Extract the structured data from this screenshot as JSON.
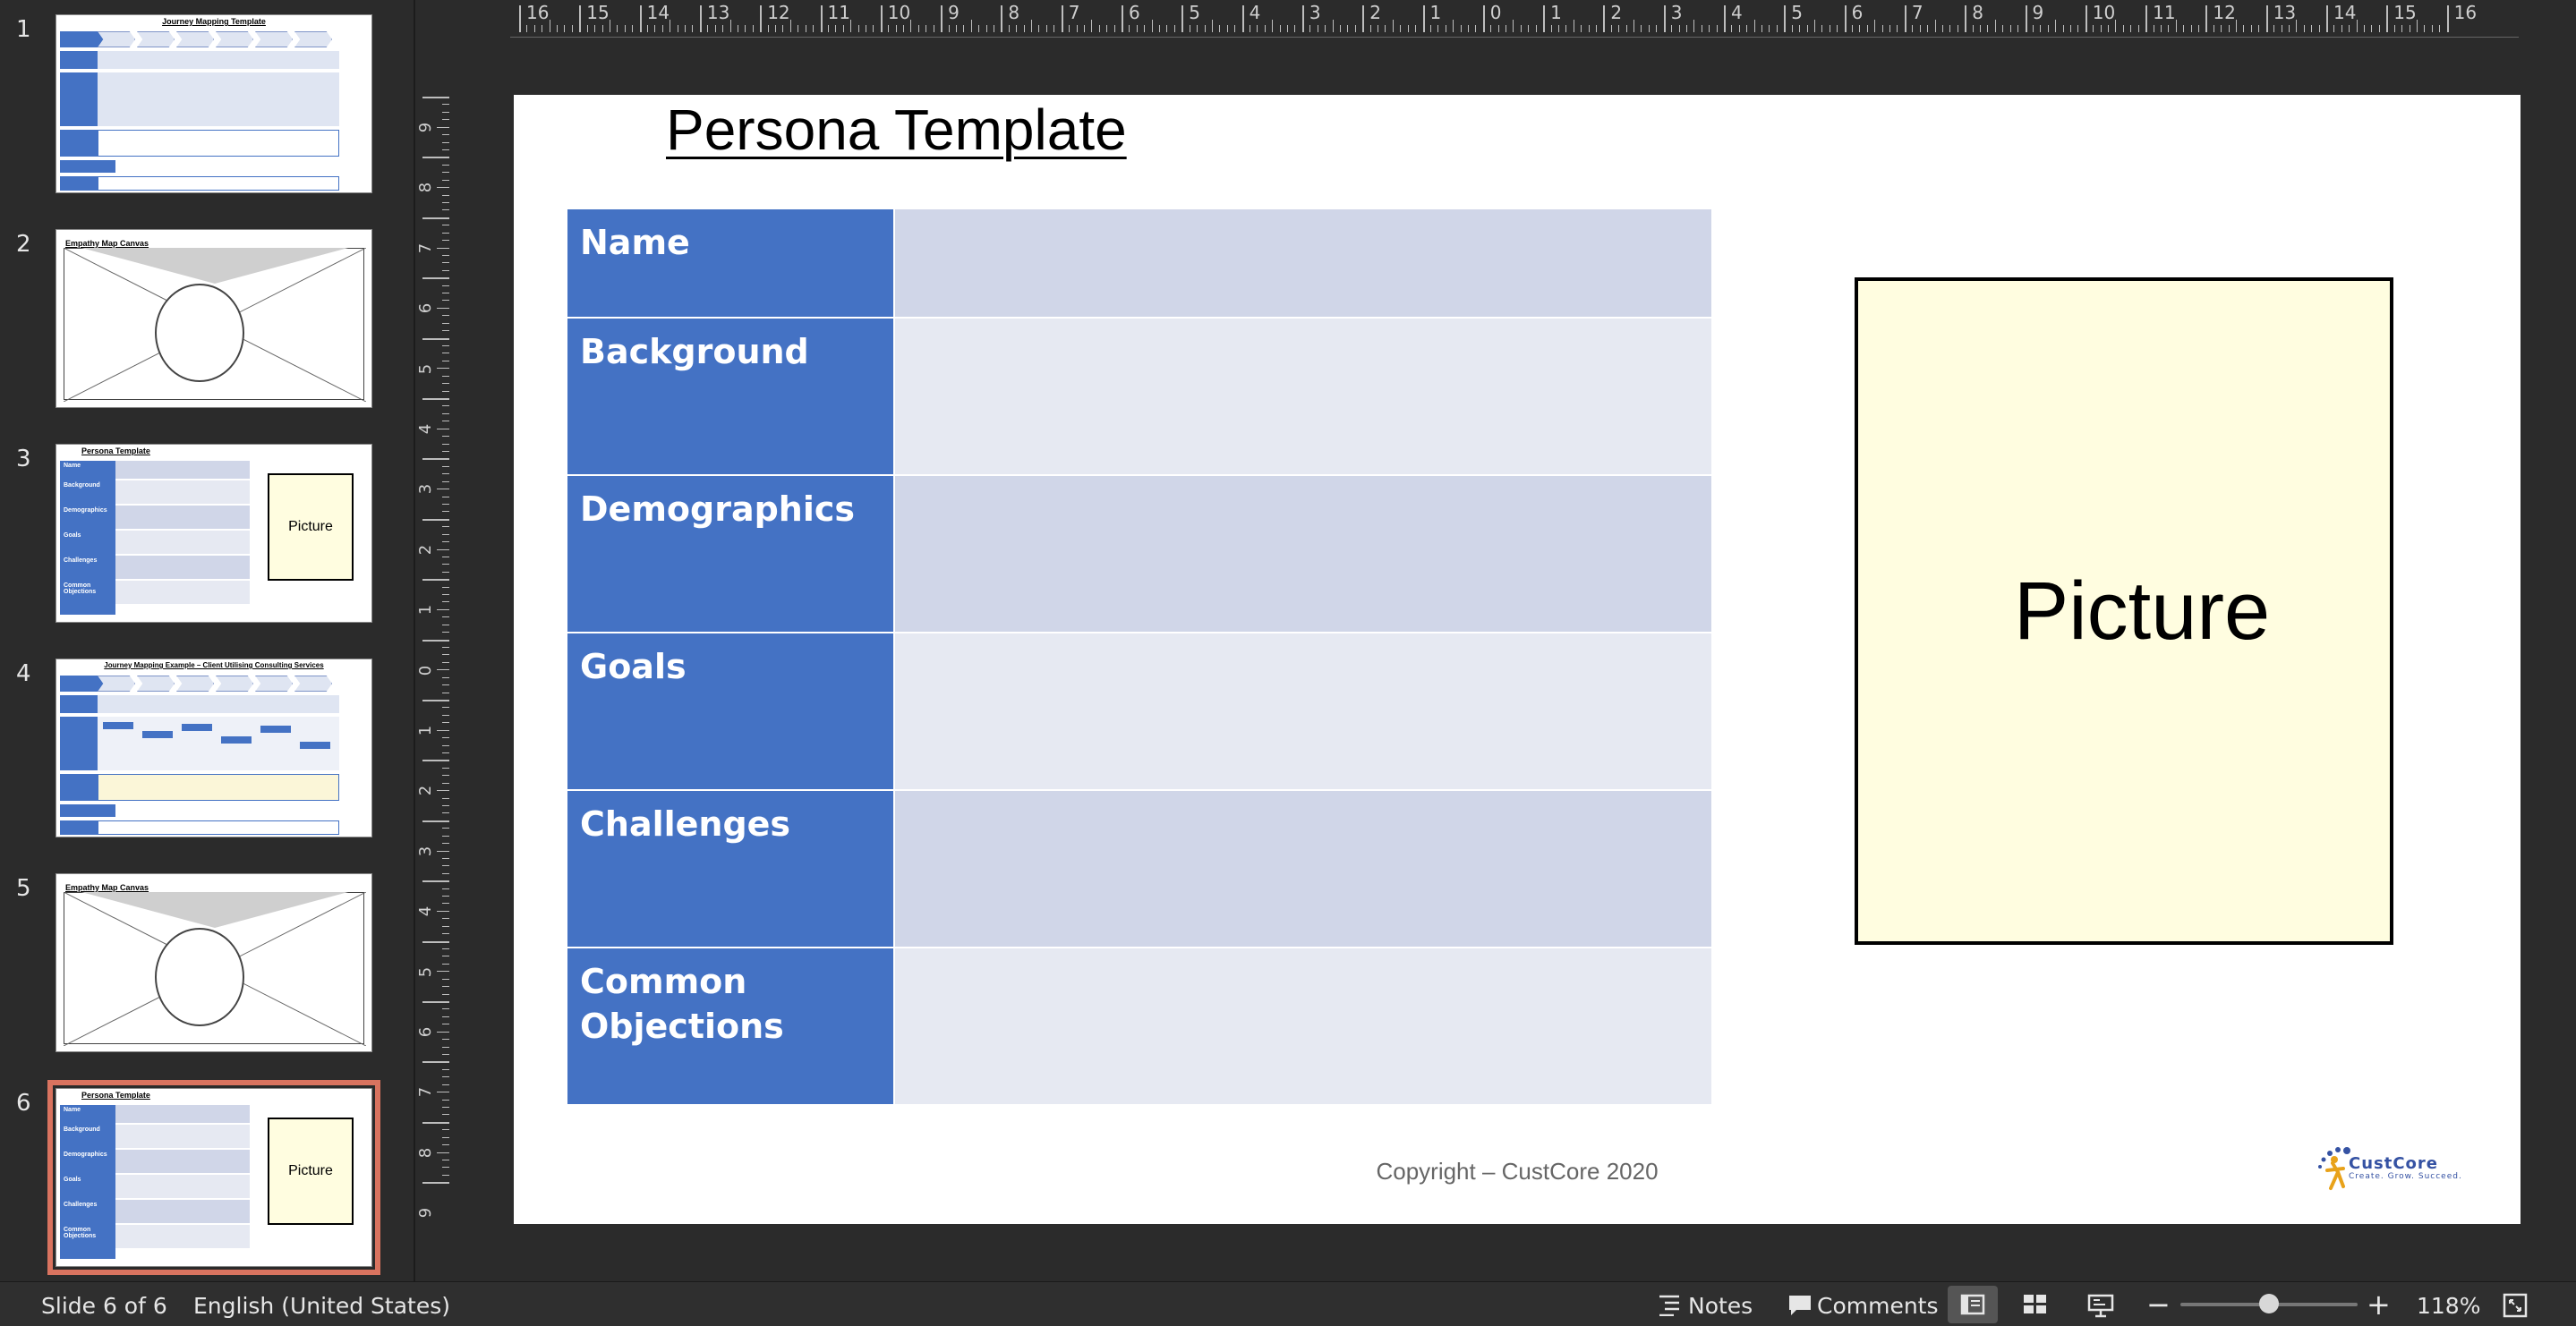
{
  "sidebar": {
    "slides": [
      {
        "number": "1",
        "title": "Journey Mapping Template"
      },
      {
        "number": "2",
        "title": "Empathy Map Canvas"
      },
      {
        "number": "3",
        "title": "Persona Template",
        "picture_label": "Picture"
      },
      {
        "number": "4",
        "title": "Journey Mapping Example – Client Utilising Consulting Services"
      },
      {
        "number": "5",
        "title": "Empathy Map Canvas"
      },
      {
        "number": "6",
        "title": "Persona Template",
        "picture_label": "Picture",
        "selected": true
      }
    ],
    "thumb_rows": [
      "Name",
      "Background",
      "Demographics",
      "Goals",
      "Challenges",
      "Common Objections"
    ]
  },
  "ruler": {
    "horizontal_labels": [
      "16",
      "15",
      "14",
      "13",
      "12",
      "11",
      "10",
      "9",
      "8",
      "7",
      "6",
      "5",
      "4",
      "3",
      "2",
      "1",
      "0",
      "1",
      "2",
      "3",
      "4",
      "5",
      "6",
      "7",
      "8",
      "9",
      "10",
      "11",
      "12",
      "13",
      "14",
      "15",
      "16"
    ],
    "vertical_labels": [
      "9",
      "8",
      "7",
      "6",
      "5",
      "4",
      "3",
      "2",
      "1",
      "0",
      "1",
      "2",
      "3",
      "4",
      "5",
      "6",
      "7",
      "8",
      "9"
    ]
  },
  "slide": {
    "title": "Persona Template",
    "rows": [
      {
        "label": "Name"
      },
      {
        "label": "Background"
      },
      {
        "label": "Demographics"
      },
      {
        "label": "Goals"
      },
      {
        "label": "Challenges"
      },
      {
        "label": "Common Objections"
      }
    ],
    "picture_label": "Picture",
    "copyright": "Copyright – CustCore 2020",
    "logo": {
      "name": "CustCore",
      "tagline": "Create. Grow. Succeed."
    }
  },
  "statusbar": {
    "slide_info": "Slide 6 of 6",
    "language": "English (United States)",
    "notes_label": "Notes",
    "comments_label": "Comments",
    "zoom_level": "118%",
    "zoom_fraction": 0.5
  },
  "colors": {
    "label_blue": "#4472c4",
    "cell_dark": "#d0d6e8",
    "cell_light": "#e6e9f2",
    "picture_fill": "#fffde0",
    "selection_outline": "#d9735f"
  }
}
